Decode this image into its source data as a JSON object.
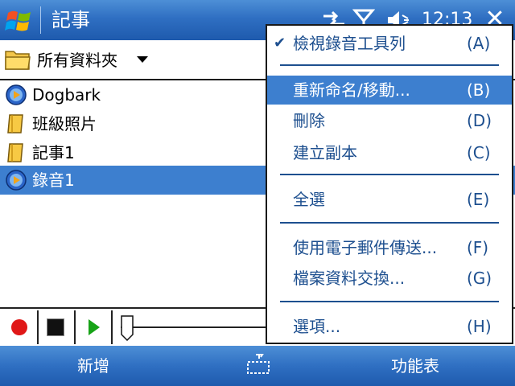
{
  "titlebar": {
    "title": "記事",
    "clock": "12:13",
    "close": "✕",
    "icons": [
      "connectivity-icon",
      "signal-icon",
      "volume-icon"
    ]
  },
  "folderbar": {
    "label": "所有資料夾"
  },
  "files": [
    {
      "name": "Dogbark",
      "icon": "media-icon",
      "selected": false
    },
    {
      "name": "班級照片",
      "icon": "notebook-icon",
      "selected": false
    },
    {
      "name": "記事1",
      "icon": "notebook-icon",
      "selected": false
    },
    {
      "name": "錄音1",
      "icon": "media-icon",
      "selected": true
    }
  ],
  "menu": {
    "items": [
      {
        "label": "檢視錄音工具列",
        "key": "(A)",
        "checked": true,
        "highlight": false
      },
      {
        "label": "重新命名/移動...",
        "key": "(B)",
        "checked": false,
        "highlight": true
      },
      {
        "label": "刪除",
        "key": "(D)",
        "checked": false,
        "highlight": false
      },
      {
        "label": "建立副本",
        "key": "(C)",
        "checked": false,
        "highlight": false
      },
      {
        "label": "全選",
        "key": "(E)",
        "checked": false,
        "highlight": false
      },
      {
        "label": "使用電子郵件傳送...",
        "key": "(F)",
        "checked": false,
        "highlight": false
      },
      {
        "label": "檔案資料交換...",
        "key": "(G)",
        "checked": false,
        "highlight": false
      },
      {
        "label": "選項...",
        "key": "(H)",
        "checked": false,
        "highlight": false
      }
    ]
  },
  "softkeys": {
    "left": "新增",
    "right": "功能表"
  },
  "colors": {
    "titlebar": "#2f6fc2",
    "selection": "#3d7fcf",
    "menu_text": "#1d4f8f",
    "record": "#e01818",
    "play": "#17a317"
  }
}
